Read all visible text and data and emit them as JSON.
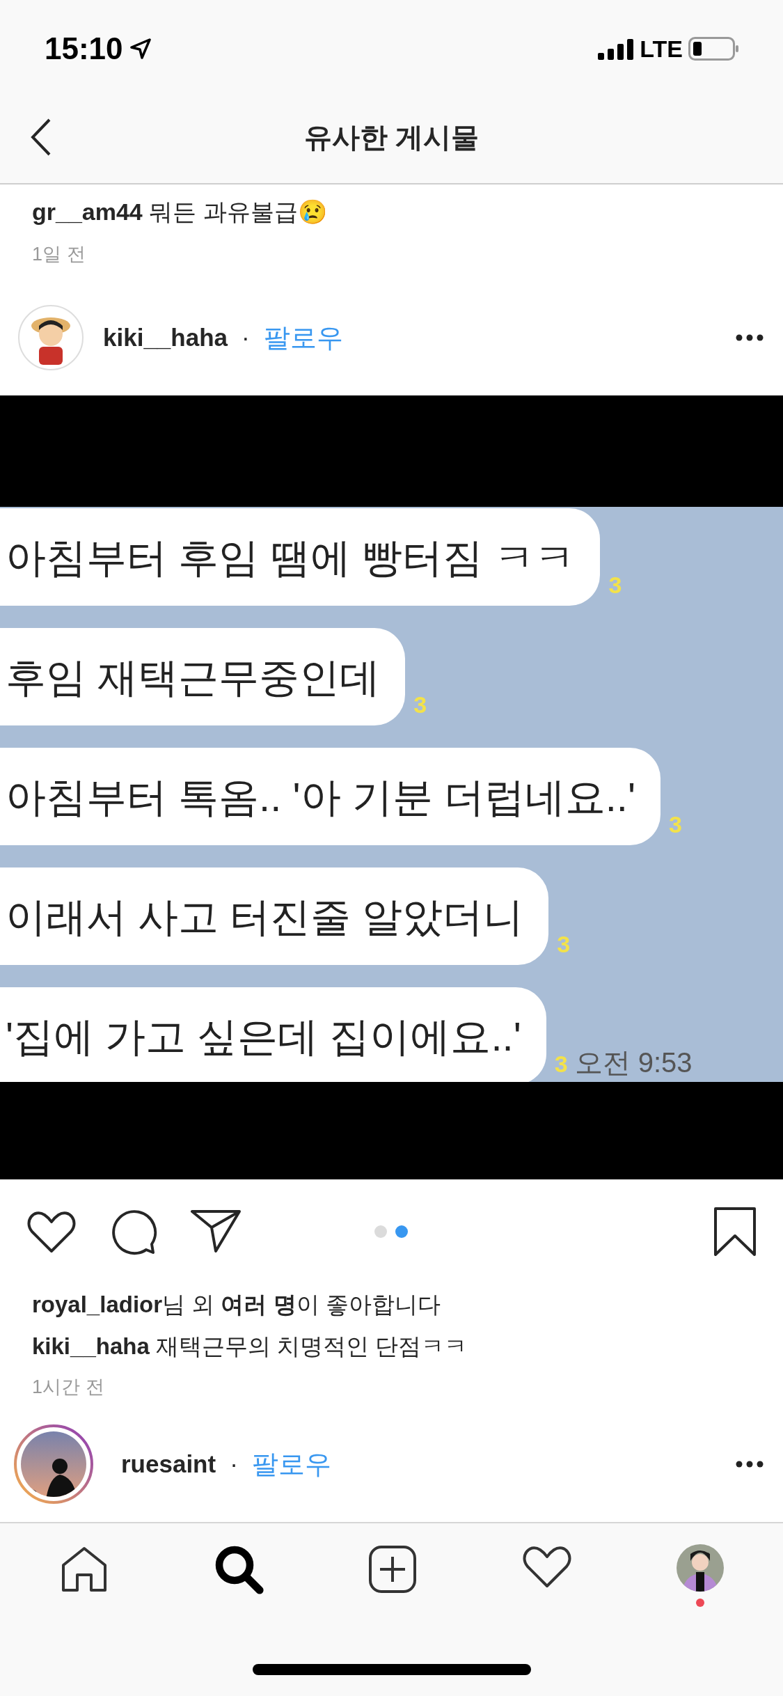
{
  "status_bar": {
    "time": "15:10",
    "network": "LTE"
  },
  "header": {
    "title": "유사한 게시물"
  },
  "prev_comment": {
    "user": "gr__am44",
    "text": "뭐든 과유불급😢",
    "time": "1일 전"
  },
  "post": {
    "user": "kiki__haha",
    "follow": "팔로우",
    "separator": "·",
    "chat_image": {
      "messages": [
        {
          "text": "아침부터 후임 땜에 빵터짐 ㅋㅋ",
          "unread": "3"
        },
        {
          "text": "후임 재택근무중인데",
          "unread": "3"
        },
        {
          "text": "아침부터 톡옴.. '아 기분 더럽네요..'",
          "unread": "3"
        },
        {
          "text": "이래서 사고 터진줄 알았더니",
          "unread": "3"
        },
        {
          "text": "'집에 가고 싶은데 집이에요..'",
          "unread": "3",
          "time": "오전 9:53"
        }
      ]
    },
    "pages": [
      {
        "selected": false
      },
      {
        "selected": true
      }
    ],
    "likes": "**royal_ladior**님 외 **여러 명**이 좋아합니다",
    "caption": {
      "user": "kiki__haha",
      "text": "재택근무의 치명적인 단점ㅋㅋ"
    },
    "time": "1시간 전"
  },
  "next_post": {
    "user": "ruesaint",
    "follow": "팔로우",
    "separator": "·"
  },
  "tab_bar": [
    {
      "kind": "home",
      "selected": false
    },
    {
      "kind": "search",
      "selected": true
    },
    {
      "kind": "add",
      "selected": false
    },
    {
      "kind": "activity",
      "selected": false
    },
    {
      "kind": "profile",
      "selected": false,
      "notification": true
    }
  ]
}
